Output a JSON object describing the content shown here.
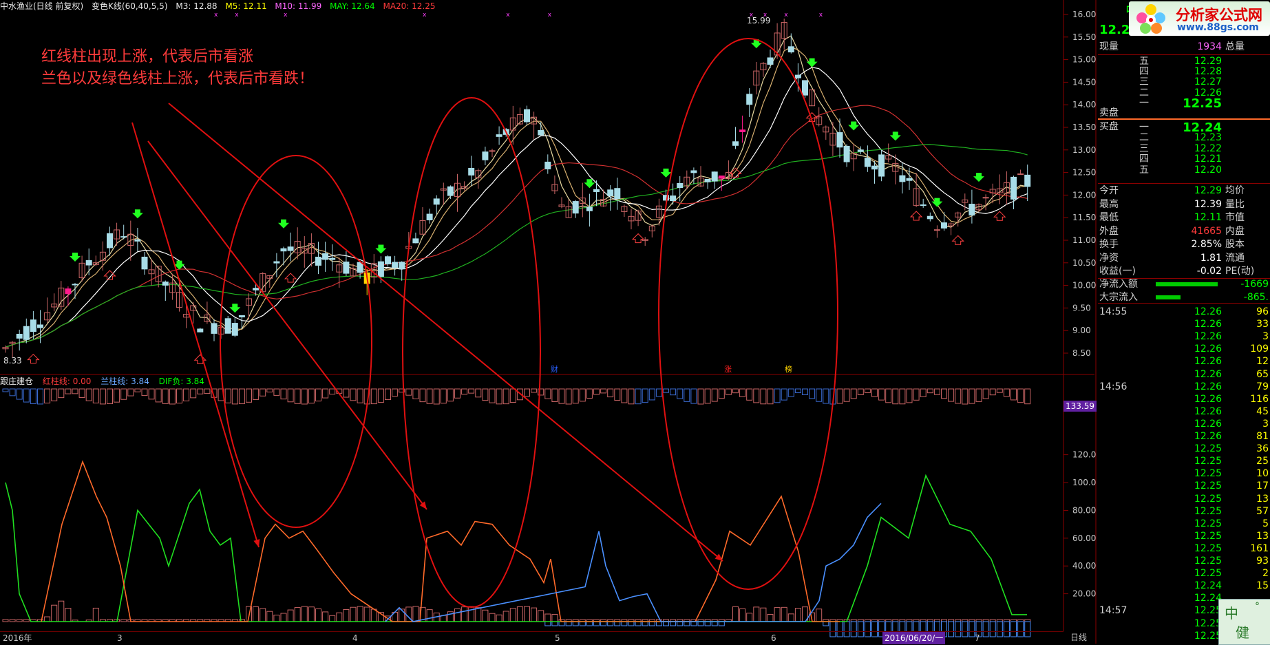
{
  "header": {
    "stock": "中水渔业(日线 前复权)",
    "indicator": "变色K线(60,40,5,5)",
    "m3": "M3: 12.88",
    "m5": "M5: 12.11",
    "m10": "M10: 11.99",
    "may": "MAY: 12.64",
    "ma20": "MA20: 12.25"
  },
  "annotation": {
    "line1": "红线柱出现上涨，代表后市看涨",
    "line2": "兰色以及绿色线柱上涨，代表后市看跌！"
  },
  "price_axis": [
    "16.00",
    "15.50",
    "15.00",
    "14.50",
    "14.00",
    "13.50",
    "13.00",
    "12.50",
    "12.00",
    "11.50",
    "11.00",
    "10.50",
    "10.00",
    "9.50",
    "9.00",
    "8.50"
  ],
  "price_marks": {
    "high": "15.99",
    "low": "8.33"
  },
  "chart_markers": [
    "财",
    "涨",
    "榜"
  ],
  "indicator_panel": {
    "name": "跟庄建仓",
    "red": "红柱线: 0.00",
    "blue": "兰柱线: 3.84",
    "dif": "DIF负: 3.84",
    "top_value": "133.59",
    "axis": [
      "120.0",
      "100.0",
      "80.00",
      "60.00",
      "40.00",
      "20.00"
    ]
  },
  "time_axis": {
    "ticks": [
      "2016年",
      "3",
      "4",
      "5",
      "6",
      "7"
    ],
    "cursor_date": "2016/06/20/一",
    "period": "日线"
  },
  "logo": {
    "title": "分析家公式网",
    "url": "www.88gs.com"
  },
  "quote": {
    "code_char": "中",
    "price": "12.25",
    "now_vol_label": "现量",
    "now_vol": "1934",
    "total_vol_label": "总量",
    "asks": [
      {
        "label": "五",
        "price": "12.29"
      },
      {
        "label": "四",
        "price": "12.28"
      },
      {
        "label": "三",
        "price": "12.27"
      },
      {
        "label": "二",
        "price": "12.26"
      },
      {
        "label": "一",
        "price": "12.25"
      }
    ],
    "sell_label": "卖盘",
    "buy_label": "买盘",
    "bids": [
      {
        "label": "一",
        "price": "12.24"
      },
      {
        "label": "二",
        "price": "12.23"
      },
      {
        "label": "三",
        "price": "12.22"
      },
      {
        "label": "四",
        "price": "12.21"
      },
      {
        "label": "五",
        "price": "12.20"
      }
    ],
    "stats": [
      {
        "l1": "今开",
        "v1": "12.29",
        "l2": "均价",
        "c": "g"
      },
      {
        "l1": "最高",
        "v1": "12.39",
        "l2": "量比",
        "c": "w"
      },
      {
        "l1": "最低",
        "v1": "12.11",
        "l2": "市值",
        "c": "g"
      },
      {
        "l1": "外盘",
        "v1": "41665",
        "l2": "内盘",
        "c": "r"
      },
      {
        "l1": "换手",
        "v1": "2.85%",
        "l2": "股本",
        "c": "w"
      },
      {
        "l1": "净资",
        "v1": "1.81",
        "l2": "流通",
        "c": "w"
      },
      {
        "l1": "收益(一)",
        "v1": "-0.02",
        "l2": "PE(动)",
        "c": "w"
      }
    ],
    "net_inflow_label": "净流入额",
    "net_inflow": "-1669",
    "block_inflow_label": "大宗流入",
    "block_inflow": "-865."
  },
  "ticks": [
    {
      "time": "14:55",
      "price": "12.26",
      "vol": "96"
    },
    {
      "time": "",
      "price": "12.26",
      "vol": "33"
    },
    {
      "time": "",
      "price": "12.26",
      "vol": "3"
    },
    {
      "time": "",
      "price": "12.26",
      "vol": "109"
    },
    {
      "time": "",
      "price": "12.26",
      "vol": "12"
    },
    {
      "time": "",
      "price": "12.26",
      "vol": "65"
    },
    {
      "time": "14:56",
      "price": "12.26",
      "vol": "79"
    },
    {
      "time": "",
      "price": "12.26",
      "vol": "116"
    },
    {
      "time": "",
      "price": "12.26",
      "vol": "45"
    },
    {
      "time": "",
      "price": "12.26",
      "vol": "3"
    },
    {
      "time": "",
      "price": "12.26",
      "vol": "81"
    },
    {
      "time": "",
      "price": "12.25",
      "vol": "36"
    },
    {
      "time": "",
      "price": "12.25",
      "vol": "25"
    },
    {
      "time": "",
      "price": "12.25",
      "vol": "10"
    },
    {
      "time": "",
      "price": "12.25",
      "vol": "17"
    },
    {
      "time": "",
      "price": "12.25",
      "vol": "13"
    },
    {
      "time": "",
      "price": "12.25",
      "vol": "57"
    },
    {
      "time": "",
      "price": "12.25",
      "vol": "5"
    },
    {
      "time": "",
      "price": "12.25",
      "vol": "13"
    },
    {
      "time": "",
      "price": "12.25",
      "vol": "161"
    },
    {
      "time": "",
      "price": "12.25",
      "vol": "93"
    },
    {
      "time": "",
      "price": "12.25",
      "vol": "2"
    },
    {
      "time": "",
      "price": "12.24",
      "vol": "15"
    },
    {
      "time": "",
      "price": "12.24",
      "vol": ""
    },
    {
      "time": "14:57",
      "price": "12.25",
      "vol": ""
    },
    {
      "time": "",
      "price": "12.25",
      "vol": ""
    },
    {
      "time": "",
      "price": "12.25",
      "vol": ""
    }
  ],
  "corner": {
    "c1": "中",
    "c2": "健",
    "c3": "°"
  },
  "colors": {
    "red": "#ff3b3b",
    "green": "#00ff00",
    "cyan": "#a8dde8",
    "magenta": "#ff1a8c",
    "orange": "#ff6a2a",
    "blue": "#4a90ff"
  }
}
